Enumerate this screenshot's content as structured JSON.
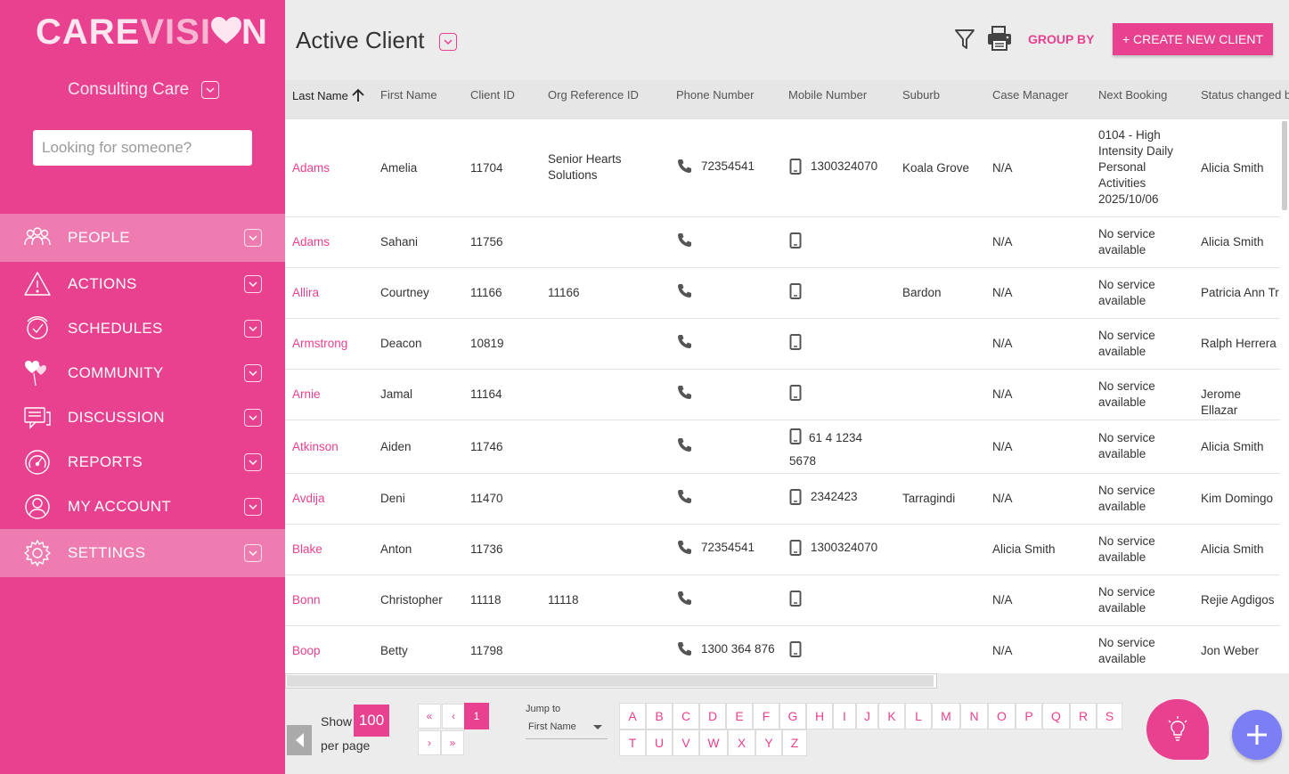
{
  "sidebar": {
    "logo": {
      "part1": "CARE",
      "part2": "VISI",
      "part3": "N"
    },
    "org_name": "Consulting Care",
    "search_placeholder": "Looking for someone?",
    "items": [
      {
        "label": "PEOPLE",
        "icon": "people-icon",
        "active": true
      },
      {
        "label": "ACTIONS",
        "icon": "warning-icon",
        "active": false
      },
      {
        "label": "SCHEDULES",
        "icon": "clock-icon",
        "active": false
      },
      {
        "label": "COMMUNITY",
        "icon": "hearts-icon",
        "active": false
      },
      {
        "label": "DISCUSSION",
        "icon": "chat-icon",
        "active": false
      },
      {
        "label": "REPORTS",
        "icon": "gauge-icon",
        "active": false
      },
      {
        "label": "MY ACCOUNT",
        "icon": "user-icon",
        "active": false
      },
      {
        "label": "SETTINGS",
        "icon": "gear-icon",
        "active": true
      }
    ]
  },
  "header": {
    "title": "Active Client",
    "group_by": "GROUP BY",
    "create_button": "+ CREATE NEW CLIENT"
  },
  "table": {
    "columns": [
      "Last Name",
      "First Name",
      "Client ID",
      "Org Reference ID",
      "Phone Number",
      "Mobile Number",
      "Suburb",
      "Case Manager",
      "Next Booking",
      "Status changed by"
    ],
    "rows": [
      {
        "last": "Adams",
        "first": "Amelia",
        "id": "11704",
        "org": "Senior Hearts Solutions",
        "phone": "72354541",
        "mobile": "1300324070",
        "suburb": "Koala Grove",
        "manager": "N/A",
        "booking": "0104 - High Intensity Daily Personal Activities 2025/10/06",
        "status": "Alicia Smith"
      },
      {
        "last": "Adams",
        "first": "Sahani",
        "id": "11756",
        "org": "",
        "phone": "",
        "mobile": "",
        "suburb": "",
        "manager": "N/A",
        "booking": "No service available",
        "status": "Alicia Smith"
      },
      {
        "last": "Allira",
        "first": "Courtney",
        "id": "11166",
        "org": "11166",
        "phone": "",
        "mobile": "",
        "suburb": "Bardon",
        "manager": "N/A",
        "booking": "No service available",
        "status": "Patricia Ann Tr"
      },
      {
        "last": "Armstrong",
        "first": "Deacon",
        "id": "10819",
        "org": "",
        "phone": "",
        "mobile": "",
        "suburb": "",
        "manager": "N/A",
        "booking": "No service available",
        "status": "Ralph Herrera"
      },
      {
        "last": "Arnie",
        "first": "Jamal",
        "id": "11164",
        "org": "",
        "phone": "",
        "mobile": "",
        "suburb": "",
        "manager": "N/A",
        "booking": "No service available",
        "status": "Jerome Ellazar"
      },
      {
        "last": "Atkinson",
        "first": "Aiden",
        "id": "11746",
        "org": "",
        "phone": "",
        "mobile": "61 4 1234 5678",
        "suburb": "",
        "manager": "N/A",
        "booking": "No service available",
        "status": "Alicia Smith"
      },
      {
        "last": "Avdija",
        "first": "Deni",
        "id": "11470",
        "org": "",
        "phone": "",
        "mobile": "2342423",
        "suburb": "Tarragindi",
        "manager": "N/A",
        "booking": "No service available",
        "status": "Kim Domingo"
      },
      {
        "last": "Blake",
        "first": "Anton",
        "id": "11736",
        "org": "",
        "phone": "72354541",
        "mobile": "1300324070",
        "suburb": "",
        "manager": "Alicia Smith",
        "booking": "No service available",
        "status": "Alicia Smith"
      },
      {
        "last": "Bonn",
        "first": "Christopher",
        "id": "11118",
        "org": "11118",
        "phone": "",
        "mobile": "",
        "suburb": "",
        "manager": "N/A",
        "booking": "No service available",
        "status": "Rejie Agdigos"
      },
      {
        "last": "Boop",
        "first": "Betty",
        "id": "11798",
        "org": "",
        "phone": "1300 364 876",
        "mobile": "",
        "suburb": "",
        "manager": "N/A",
        "booking": "No service available",
        "status": "Jon Weber"
      }
    ]
  },
  "pagination": {
    "show_label": "Show",
    "page_size": "100",
    "per_page_label": "per page",
    "first": "«",
    "prev": "‹",
    "current_page": "1",
    "next": "›",
    "last": "»",
    "jump_label": "Jump to",
    "jump_value": "First Name",
    "letters_row1": [
      "A",
      "B",
      "C",
      "D",
      "E",
      "F",
      "G",
      "H",
      "I",
      "J",
      "K",
      "L",
      "M",
      "N",
      "O",
      "P",
      "Q",
      "R",
      "S"
    ],
    "letters_row2": [
      "T",
      "U",
      "V",
      "W",
      "X",
      "Y",
      "Z"
    ]
  },
  "colors": {
    "brand": "#e8418f",
    "brand_light": "#ee7cb0",
    "fab": "#7b7ef5"
  }
}
